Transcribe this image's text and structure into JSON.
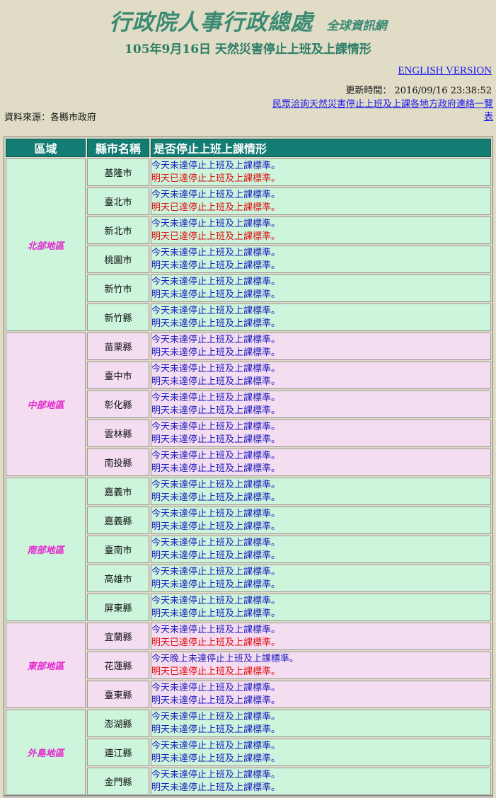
{
  "header": {
    "title": "行政院人事行政總處",
    "subtitle": "全球資訊網",
    "event_title": "105年9月16日 天然災害停止上班及上課情形",
    "english_link": "ENGLISH VERSION",
    "update_time": "更新時間： 2016/09/16 23:38:52",
    "source": "資料來源：各縣市政府",
    "contact_link": "民眾洽詢天然災害停止上班及上課各地方政府連絡一覽表"
  },
  "table": {
    "headers": [
      "區域",
      "縣市名稱",
      "是否停止上班上課情形"
    ],
    "regions": [
      {
        "name": "北部地區",
        "rows": [
          {
            "county": "基隆市",
            "today": "今天未達停止上班及上課標準。",
            "tomorrow": "明天已達停止上班及上課標準。",
            "tomorrow_off": true
          },
          {
            "county": "臺北市",
            "today": "今天未達停止上班及上課標準。",
            "tomorrow": "明天已達停止上班及上課標準。",
            "tomorrow_off": true
          },
          {
            "county": "新北市",
            "today": "今天未達停止上班及上課標準。",
            "tomorrow": "明天已達停止上班及上課標準。",
            "tomorrow_off": true
          },
          {
            "county": "桃園市",
            "today": "今天未達停止上班及上課標準。",
            "tomorrow": "明天未達停止上班及上課標準。",
            "tomorrow_off": false
          },
          {
            "county": "新竹市",
            "today": "今天未達停止上班及上課標準。",
            "tomorrow": "明天未達停止上班及上課標準。",
            "tomorrow_off": false
          },
          {
            "county": "新竹縣",
            "today": "今天未達停止上班及上課標準。",
            "tomorrow": "明天未達停止上班及上課標準。",
            "tomorrow_off": false
          }
        ]
      },
      {
        "name": "中部地區",
        "rows": [
          {
            "county": "苗栗縣",
            "today": "今天未達停止上班及上課標準。",
            "tomorrow": "明天未達停止上班及上課標準。",
            "tomorrow_off": false
          },
          {
            "county": "臺中市",
            "today": "今天未達停止上班及上課標準。",
            "tomorrow": "明天未達停止上班及上課標準。",
            "tomorrow_off": false
          },
          {
            "county": "彰化縣",
            "today": "今天未達停止上班及上課標準。",
            "tomorrow": "明天未達停止上班及上課標準。",
            "tomorrow_off": false
          },
          {
            "county": "雲林縣",
            "today": "今天未達停止上班及上課標準。",
            "tomorrow": "明天未達停止上班及上課標準。",
            "tomorrow_off": false
          },
          {
            "county": "南投縣",
            "today": "今天未達停止上班及上課標準。",
            "tomorrow": "明天未達停止上班及上課標準。",
            "tomorrow_off": false
          }
        ]
      },
      {
        "name": "南部地區",
        "rows": [
          {
            "county": "嘉義市",
            "today": "今天未達停止上班及上課標準。",
            "tomorrow": "明天未達停止上班及上課標準。",
            "tomorrow_off": false
          },
          {
            "county": "嘉義縣",
            "today": "今天未達停止上班及上課標準。",
            "tomorrow": "明天未達停止上班及上課標準。",
            "tomorrow_off": false
          },
          {
            "county": "臺南市",
            "today": "今天未達停止上班及上課標準。",
            "tomorrow": "明天未達停止上班及上課標準。",
            "tomorrow_off": false
          },
          {
            "county": "高雄市",
            "today": "今天未達停止上班及上課標準。",
            "tomorrow": "明天未達停止上班及上課標準。",
            "tomorrow_off": false
          },
          {
            "county": "屏東縣",
            "today": "今天未達停止上班及上課標準。",
            "tomorrow": "明天未達停止上班及上課標準。",
            "tomorrow_off": false
          }
        ]
      },
      {
        "name": "東部地區",
        "rows": [
          {
            "county": "宜蘭縣",
            "today": "今天未達停止上班及上課標準。",
            "tomorrow": "明天已達停止上班及上課標準。",
            "tomorrow_off": true
          },
          {
            "county": "花蓮縣",
            "today": "今天晚上未達停止上班及上課標準。",
            "tomorrow": "明天已達停止上班及上課標準。",
            "tomorrow_off": true
          },
          {
            "county": "臺東縣",
            "today": "今天未達停止上班及上課標準。",
            "tomorrow": "明天未達停止上班及上課標準。",
            "tomorrow_off": false
          }
        ]
      },
      {
        "name": "外島地區",
        "rows": [
          {
            "county": "澎湖縣",
            "today": "今天未達停止上班及上課標準。",
            "tomorrow": "明天未達停止上班及上課標準。",
            "tomorrow_off": false
          },
          {
            "county": "連江縣",
            "today": "今天未達停止上班及上課標準。",
            "tomorrow": "明天未達停止上班及上課標準。",
            "tomorrow_off": false
          },
          {
            "county": "金門縣",
            "today": "今天未達停止上班及上課標準。",
            "tomorrow": "明天未達停止上班及上課標準。",
            "tomorrow_off": false
          }
        ]
      }
    ]
  },
  "colors": {
    "page_background": "#e1dcc6",
    "title": "#3a8a73",
    "header_bar": "#137d73",
    "green_band": "#ccf5dc",
    "pink_band": "#f5ddf1",
    "region_label": "#e328cf",
    "link": "#1a1aee",
    "normal_status": "#1c1cbd",
    "suspended_status": "#e01010"
  }
}
